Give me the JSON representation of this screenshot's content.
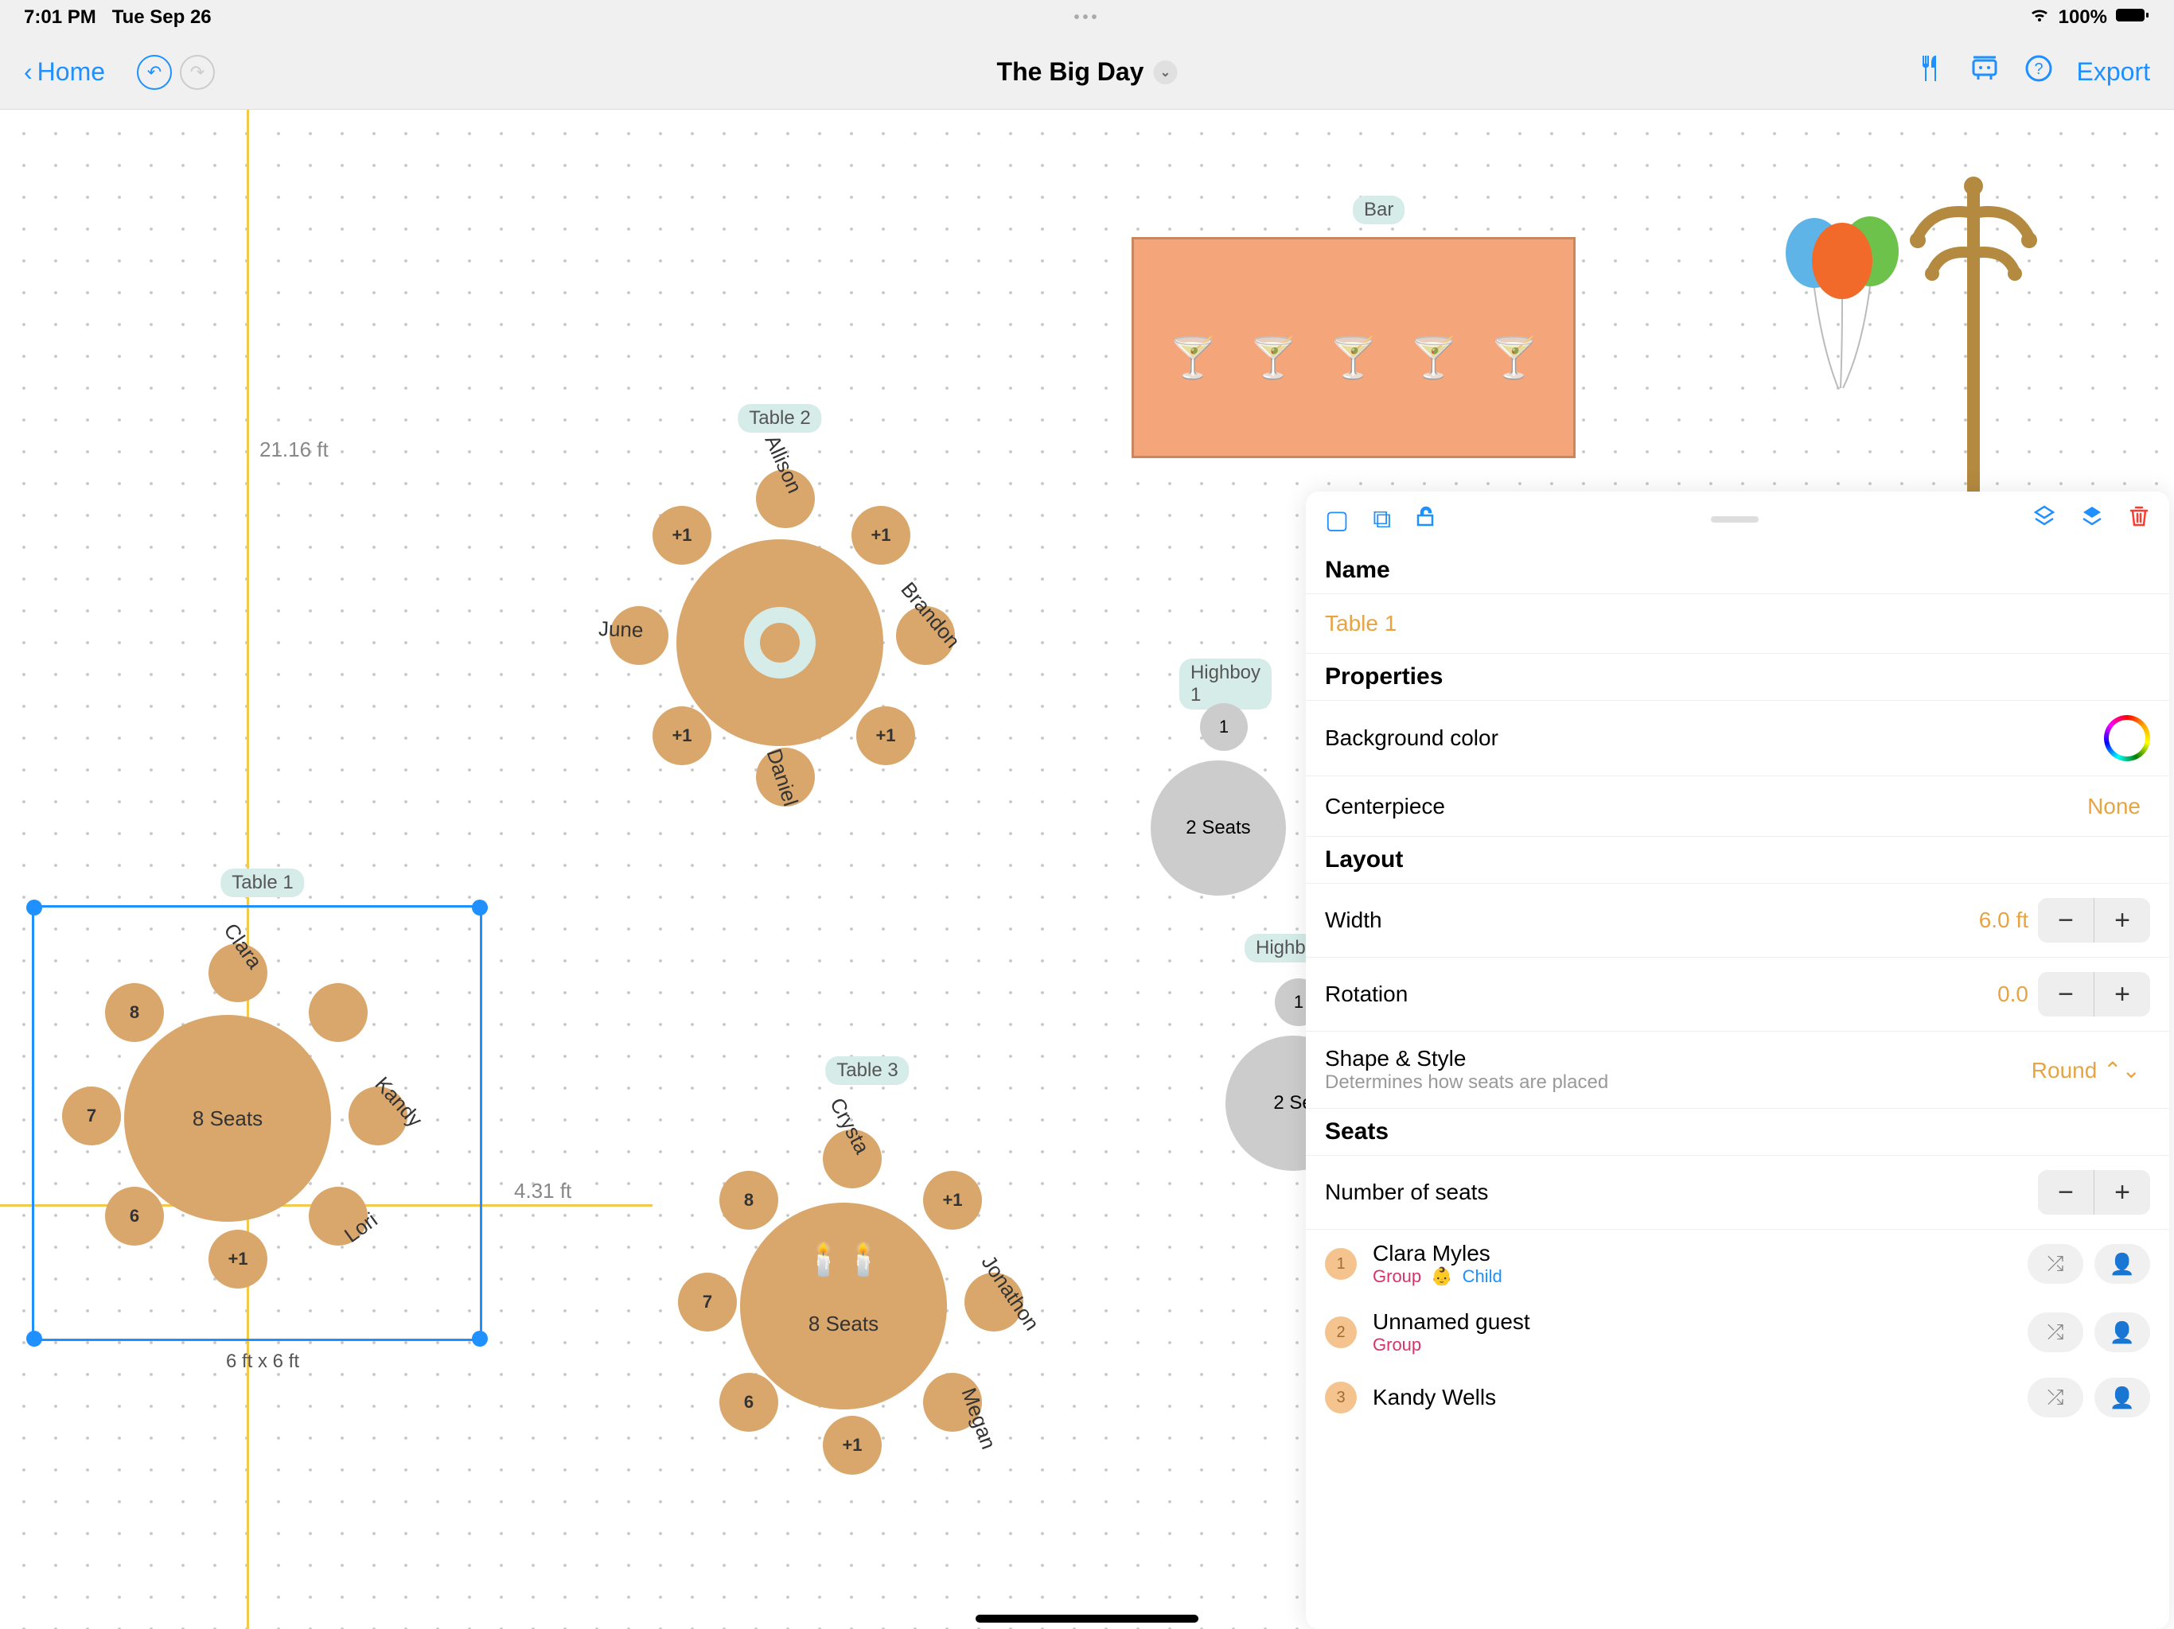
{
  "status": {
    "time": "7:01 PM",
    "date": "Tue Sep 26",
    "battery": "100%"
  },
  "toolbar": {
    "home": "Home",
    "title": "The Big Day",
    "export": "Export"
  },
  "rulers": {
    "vertical_label": "21.16 ft",
    "horizontal_label": "4.31 ft"
  },
  "bar": {
    "label": "Bar"
  },
  "table1": {
    "label": "Table 1",
    "seats_text": "8 Seats",
    "selection_caption": "6 ft x 6 ft",
    "seats": [
      "Clara",
      "",
      "Kandy",
      "Lori",
      "+1",
      "6",
      "7",
      "8"
    ]
  },
  "table2": {
    "label": "Table 2",
    "seats_text": "8 Seats",
    "seats": [
      "Allison",
      "+1",
      "Brandon",
      "+1",
      "Daniel",
      "+1",
      "June",
      "+1"
    ]
  },
  "table3": {
    "label": "Table 3",
    "seats_text": "8 Seats",
    "seats": [
      "Crysta",
      "+1",
      "Jonathon",
      "Megan",
      "+1",
      "6",
      "7",
      "8"
    ]
  },
  "highboy1": {
    "label": "Highboy 1",
    "seats_text": "2 Seats",
    "seat1": "1"
  },
  "highboy2": {
    "label": "Highb",
    "seats_text": "2 Se",
    "seat1": "1"
  },
  "panel": {
    "name_header": "Name",
    "name_value": "Table 1",
    "props_header": "Properties",
    "bgcolor_label": "Background color",
    "centerpiece_label": "Centerpiece",
    "centerpiece_value": "None",
    "layout_header": "Layout",
    "width_label": "Width",
    "width_value": "6.0",
    "width_unit": "ft",
    "rotation_label": "Rotation",
    "rotation_value": "0.0",
    "shape_label": "Shape & Style",
    "shape_sublabel": "Determines how seats are placed",
    "shape_value": "Round",
    "seats_header": "Seats",
    "numseats_label": "Number of seats",
    "guests": [
      {
        "num": "1",
        "name": "Clara Myles",
        "group": "Group",
        "child": "Child"
      },
      {
        "num": "2",
        "name": "Unnamed guest",
        "group": "Group",
        "child": ""
      },
      {
        "num": "3",
        "name": "Kandy Wells",
        "group": "",
        "child": ""
      }
    ]
  }
}
